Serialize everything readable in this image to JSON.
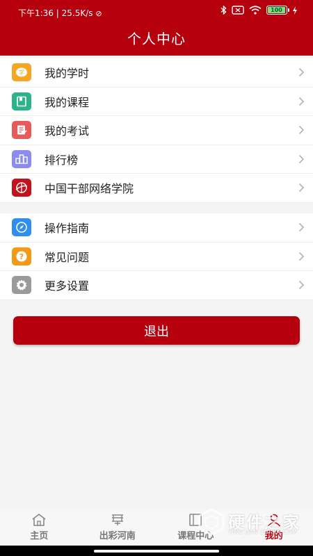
{
  "status_bar": {
    "time_speed": "下午1:36 | 25.5K/s",
    "battery_level": "100"
  },
  "header": {
    "title": "个人中心"
  },
  "menu_group1": [
    {
      "label": "我的学时",
      "icon": "study-hours-icon",
      "color": "#f5a623"
    },
    {
      "label": "我的课程",
      "icon": "course-book-icon",
      "color": "#2db38a"
    },
    {
      "label": "我的考试",
      "icon": "exam-icon",
      "color": "#e85a5a"
    },
    {
      "label": "排行榜",
      "icon": "ranking-icon",
      "color": "#8b8cf0"
    },
    {
      "label": "中国干部网络学院",
      "icon": "academy-logo-icon",
      "color": "#c4121c"
    }
  ],
  "menu_group2": [
    {
      "label": "操作指南",
      "icon": "compass-icon",
      "color": "#2f8ff0"
    },
    {
      "label": "常见问题",
      "icon": "question-icon",
      "color": "#f29a18"
    },
    {
      "label": "更多设置",
      "icon": "settings-gear-icon",
      "color": "#9a9a9a"
    }
  ],
  "logout_label": "退出",
  "tabs": [
    {
      "label": "主页",
      "icon": "home-icon"
    },
    {
      "label": "出彩河南",
      "icon": "henan-icon"
    },
    {
      "label": "课程中心",
      "icon": "course-center-icon"
    },
    {
      "label": "我的",
      "icon": "profile-icon",
      "active": true
    }
  ],
  "watermark": {
    "text": "硬件之家",
    "sub": "YING JIAN ZHI JIA.COM"
  },
  "colors": {
    "brand": "#b6000d",
    "background": "#f4f4f4"
  }
}
